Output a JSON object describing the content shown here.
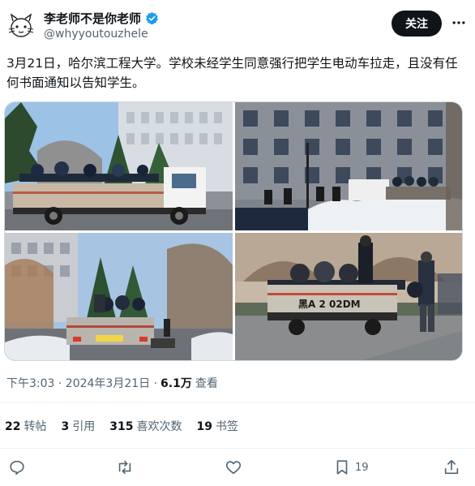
{
  "author": {
    "name": "李老师不是你老师",
    "handle": "@whyyoutouzhele",
    "verified_icon": "verified-badge-icon"
  },
  "header": {
    "follow_label": "关注",
    "more_icon": "more-options-icon"
  },
  "tweet": {
    "text": "3月21日，哈尔滨工程大学。学校未经学生同意强行把学生电动车拉走，且没有任何书面通知以告知学生。",
    "truck_plate": "黑A 2 02DM"
  },
  "meta": {
    "time": "下午3:03 · 2024年3月21日 · ",
    "views_count": "6.1万",
    "views_label": " 查看"
  },
  "stats": [
    {
      "count": "22",
      "label": "转帖"
    },
    {
      "count": "3",
      "label": "引用"
    },
    {
      "count": "315",
      "label": "喜欢次数"
    },
    {
      "count": "19",
      "label": "书签"
    }
  ],
  "actions": {
    "reply_icon": "reply-icon",
    "retweet_icon": "retweet-icon",
    "like_icon": "heart-icon",
    "bookmark_icon": "bookmark-icon",
    "bookmark_count": "19",
    "share_icon": "share-icon"
  },
  "colors": {
    "accent": "#1d9bf0",
    "text": "#0f1419",
    "secondary": "#536471",
    "follow_bg": "#0f1419"
  }
}
